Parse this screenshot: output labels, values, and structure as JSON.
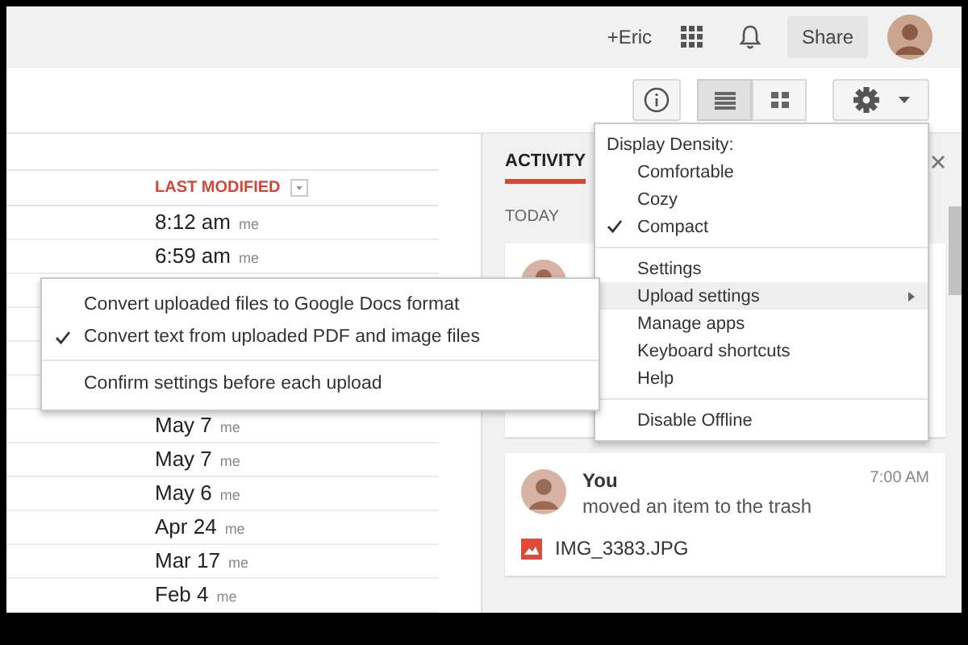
{
  "top_bar": {
    "user": "+Eric",
    "share_button": "Share"
  },
  "toolbar": {
    "view_buttons": [
      {
        "kind": "list",
        "selected": true
      },
      {
        "kind": "grid",
        "selected": false
      }
    ]
  },
  "file_list": {
    "column_header": "LAST MODIFIED",
    "rows": [
      {
        "modified": "8:12 am",
        "owner": "me"
      },
      {
        "modified": "6:59 am",
        "owner": "me"
      },
      {
        "modified": "May 7",
        "owner": "me"
      },
      {
        "modified": "May 7",
        "owner": "me"
      },
      {
        "modified": "May 6",
        "owner": "me"
      },
      {
        "modified": "Apr 24",
        "owner": "me"
      },
      {
        "modified": "Mar 17",
        "owner": "me"
      },
      {
        "modified": "Feb 4",
        "owner": "me"
      }
    ]
  },
  "activity_panel": {
    "tab": "ACTIVITY",
    "section": "TODAY",
    "entries": [
      {
        "actor": "You",
        "action": "moved an item to the trash",
        "time": "7:00 AM",
        "file": "IMG_3383.JPG"
      }
    ]
  },
  "settings_menu": {
    "items": [
      {
        "kind": "header",
        "label": "Display Density:"
      },
      {
        "kind": "option",
        "label": "Comfortable",
        "checked": false
      },
      {
        "kind": "option",
        "label": "Cozy",
        "checked": false
      },
      {
        "kind": "option",
        "label": "Compact",
        "checked": true
      },
      {
        "kind": "divider"
      },
      {
        "kind": "item",
        "label": "Settings",
        "selected": false
      },
      {
        "kind": "submenu",
        "label": "Upload settings",
        "selected": true
      },
      {
        "kind": "item",
        "label": "Manage apps",
        "selected": false
      },
      {
        "kind": "item",
        "label": "Keyboard shortcuts",
        "selected": false
      },
      {
        "kind": "item",
        "label": "Help",
        "selected": false
      },
      {
        "kind": "divider"
      },
      {
        "kind": "item",
        "label": "Disable Offline",
        "selected": false
      }
    ]
  },
  "upload_submenu": {
    "items": [
      {
        "kind": "option",
        "label": "Convert uploaded files to Google Docs format",
        "checked": false
      },
      {
        "kind": "option",
        "label": "Convert text from uploaded PDF and image files",
        "checked": true
      },
      {
        "kind": "divider"
      },
      {
        "kind": "option",
        "label": "Confirm settings before each upload",
        "checked": false
      }
    ]
  }
}
